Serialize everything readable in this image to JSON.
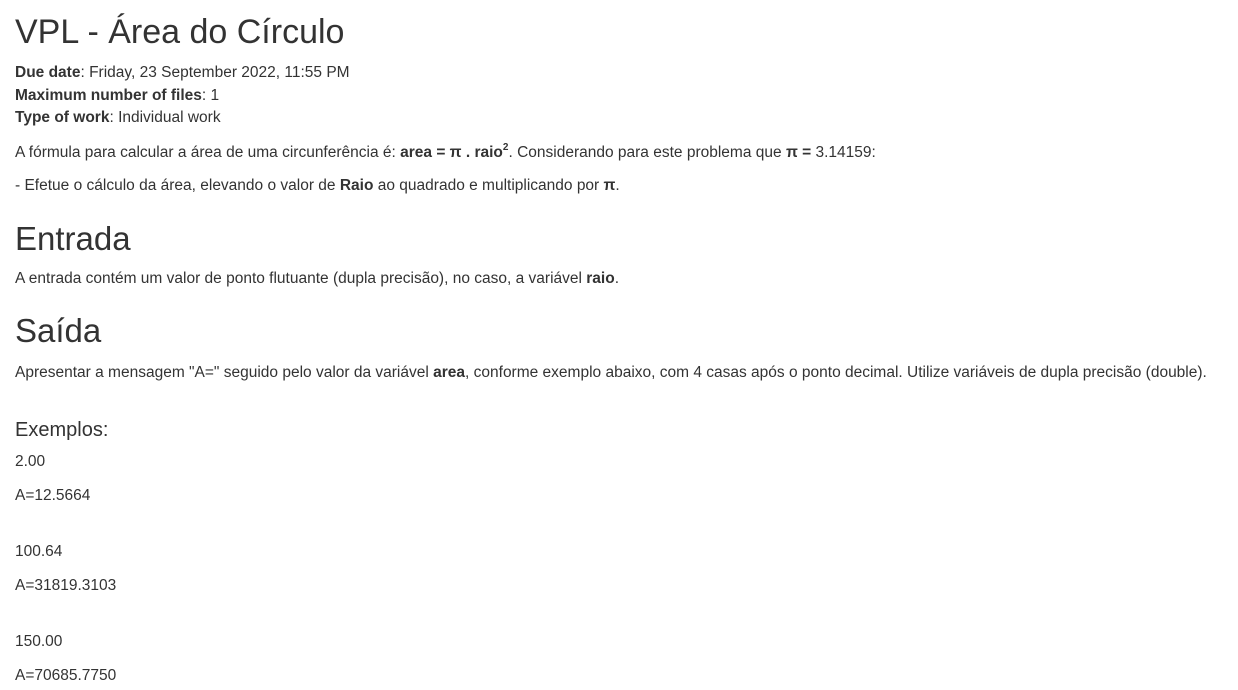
{
  "page_title": "VPL - Área do Círculo",
  "meta": [
    {
      "label": "Due date",
      "value": ": Friday, 23 September 2022, 11:55 PM"
    },
    {
      "label": "Maximum number of files",
      "value": ": 1"
    },
    {
      "label": "Type of work",
      "value": ": Individual work"
    }
  ],
  "intro": {
    "p1_a": "A fórmula para calcular a área de uma circunferência é: ",
    "p1_formula": "area = π . raio",
    "p1_sup": "2",
    "p1_b": ". Considerando para este problema que ",
    "p1_pi": "π =",
    "p1_c": " 3.14159:",
    "p2_a": "- Efetue o cálculo da área, elevando o valor de ",
    "p2_raio": "Raio",
    "p2_b": " ao quadrado e multiplicando por ",
    "p2_pi": "π",
    "p2_c": "."
  },
  "entrada": {
    "heading": "Entrada",
    "text_a": "A entrada contém um valor de ponto flutuante (dupla precisão), no caso, a variável ",
    "text_b": "raio",
    "text_c": "."
  },
  "saida": {
    "heading": "Saída",
    "text_a": "Apresentar a mensagem \"A=\" seguido pelo valor da variável ",
    "text_b": "area",
    "text_c": ", conforme exemplo abaixo, com 4 casas após o ponto decimal. Utilize variáveis de dupla precisão (double)."
  },
  "exemplos": {
    "heading": "Exemplos:",
    "items": [
      {
        "input": "2.00",
        "output": "A=12.5664"
      },
      {
        "input": "100.64",
        "output": "A=31819.3103"
      },
      {
        "input": "150.00",
        "output": "A=70685.7750"
      }
    ]
  }
}
